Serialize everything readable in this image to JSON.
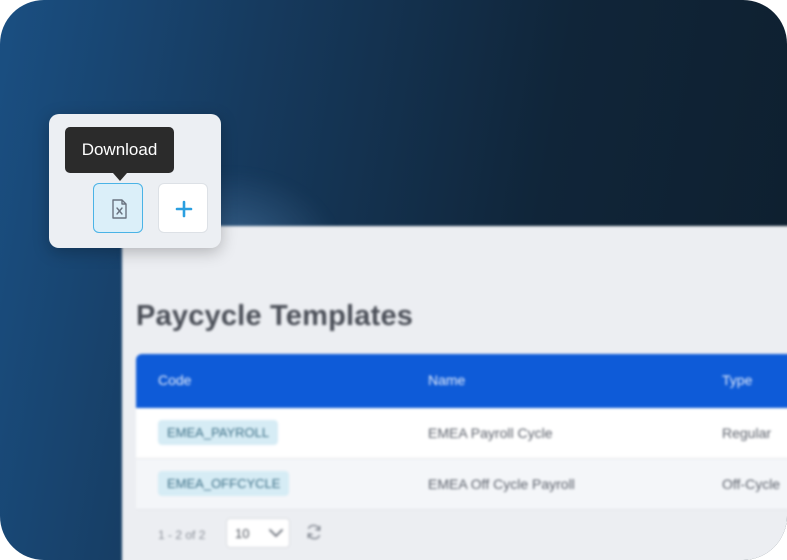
{
  "tooltip": {
    "text": "Download"
  },
  "toolbar": {
    "download_icon": "excel-file-icon",
    "add_icon": "plus-icon",
    "accent_color": "#2a9fe0"
  },
  "page": {
    "title": "Paycycle Templates"
  },
  "table": {
    "header_color": "#0e5bd8",
    "columns": [
      "Code",
      "Name",
      "Type"
    ],
    "rows": [
      {
        "code": "EMEA_PAYROLL",
        "name": "EMEA Payroll Cycle",
        "type": "Regular"
      },
      {
        "code": "EMEA_OFFCYCLE",
        "name": "EMEA Off Cycle Payroll",
        "type": "Off-Cycle"
      }
    ]
  },
  "pagination": {
    "range": "1 - 2 of 2",
    "page_size": "10",
    "refresh_icon": "refresh-icon"
  }
}
